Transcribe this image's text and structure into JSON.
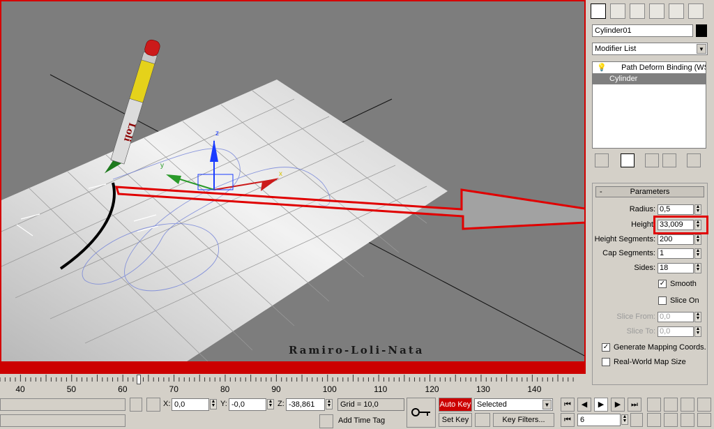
{
  "viewport": {
    "watermark": "Ramiro-Loli-Nata",
    "axes": {
      "x": "x",
      "y": "y",
      "z": "z"
    },
    "pencil_text": "Loli"
  },
  "panel": {
    "object_name": "Cylinder01",
    "modifier_list": "Modifier List",
    "stack": [
      "Path Deform Binding (WS",
      "Cylinder"
    ],
    "rollout_title": "Parameters",
    "params": {
      "radius": {
        "label": "Radius:",
        "value": "0,5"
      },
      "height": {
        "label": "Height:",
        "value": "33,009"
      },
      "height_segments": {
        "label": "Height Segments:",
        "value": "200"
      },
      "cap_segments": {
        "label": "Cap Segments:",
        "value": "1"
      },
      "sides": {
        "label": "Sides:",
        "value": "18"
      },
      "smooth": {
        "label": "Smooth",
        "checked": true
      },
      "slice_on": {
        "label": "Slice On",
        "checked": false
      },
      "slice_from": {
        "label": "Slice From:",
        "value": "0,0"
      },
      "slice_to": {
        "label": "Slice To:",
        "value": "0,0"
      },
      "gen_mapping": {
        "label": "Generate Mapping Coords.",
        "checked": true
      },
      "real_world": {
        "label": "Real-World Map Size",
        "checked": false
      }
    }
  },
  "timeline": {
    "ticks": [
      "40",
      "50",
      "60",
      "70",
      "80",
      "90",
      "100",
      "110",
      "120",
      "130",
      "140"
    ],
    "current_frame": 60
  },
  "status": {
    "x_label": "X:",
    "x": "0,0",
    "y_label": "Y:",
    "y": "-0,0",
    "z_label": "Z:",
    "z": "-38,861",
    "grid": "Grid = 10,0",
    "add_time_tag": "Add Time Tag",
    "auto_key": "Auto Key",
    "set_key": "Set Key",
    "selected": "Selected",
    "key_filters": "Key Filters...",
    "frame": "6"
  },
  "colors": {
    "accent_red": "#cc0000",
    "viewport_bg": "#7d7d7d",
    "panel_bg": "#d4d0c8"
  }
}
